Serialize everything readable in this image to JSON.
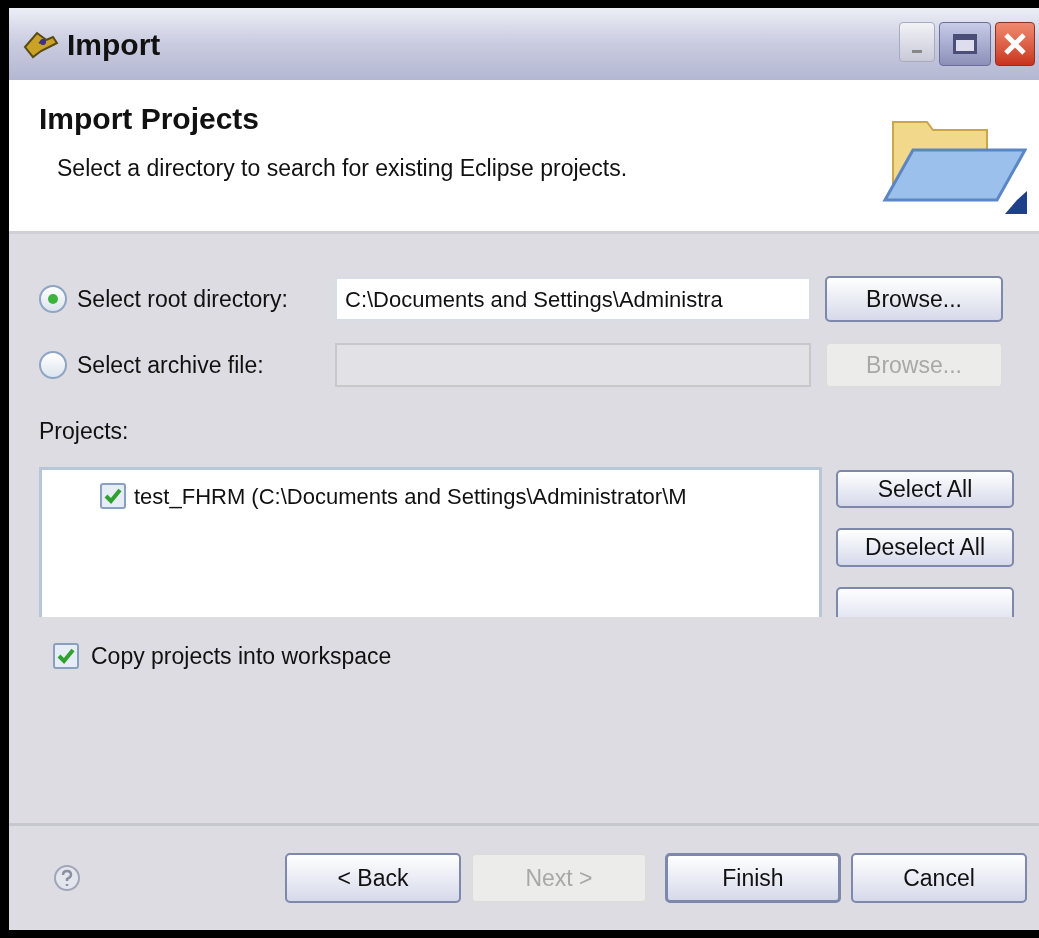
{
  "window": {
    "title": "Import"
  },
  "header": {
    "title": "Import Projects",
    "description": "Select a directory to search for existing Eclipse projects."
  },
  "sources": [
    {
      "label": "Select root directory:",
      "selected": true,
      "value": "C:\\Documents and Settings\\Administra",
      "browse": {
        "label": "Browse...",
        "disabled": false
      }
    },
    {
      "label": "Select archive file:",
      "selected": false,
      "browse": {
        "label": "Browse...",
        "disabled": true
      }
    }
  ],
  "projects": {
    "label": "Projects:",
    "items": [
      {
        "label": "test_FHRM (C:\\Documents and Settings\\Administrator\\M",
        "checked": true
      }
    ],
    "buttons": [
      "Select All",
      "Deselect All"
    ]
  },
  "copy_option": {
    "label": "Copy projects into workspace",
    "checked": true
  },
  "footer_buttons": [
    {
      "label": "< Back",
      "disabled": false,
      "default": false
    },
    {
      "label": "Next >",
      "disabled": true,
      "default": false
    },
    {
      "label": "Finish",
      "disabled": false,
      "default": true
    },
    {
      "label": "Cancel",
      "disabled": false,
      "default": false
    }
  ]
}
